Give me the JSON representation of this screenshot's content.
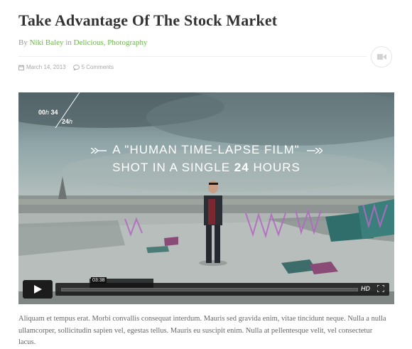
{
  "post": {
    "title": "Take Advantage Of The Stock Market",
    "by_label": "By",
    "author": "Niki Baley",
    "in_label": "in",
    "categories": [
      "Delicious",
      "Photography"
    ],
    "category_sep": ",",
    "date": "March 14, 2013",
    "comments": "5 Comments",
    "format_icon": "video-camera-icon",
    "body": "Aliquam et tempus erat. Morbi convallis consequat interdum. Mauris sed gravida enim, vitae tincidunt neque. Nulla a nulla ullamcorper, sollicitudin sapien vel, egestas tellus. Mauris eu suscipit enim. Nulla at pellentesque velit, vel consectetur lacus."
  },
  "video": {
    "timer_primary": "00",
    "timer_primary_unit": "h",
    "timer_primary_min": "34",
    "timer_total": "24",
    "timer_total_unit": "h",
    "headline_1": "A \"HUMAN TIME-LAPSE FILM\"",
    "headline_2_pre": "SHOT IN A SINGLE",
    "headline_2_num": "24",
    "headline_2_post": "HOURS",
    "current_time": "03:38",
    "hd_label": "HD",
    "progress": 0.0,
    "icons": [
      "play-icon",
      "fullscreen-icon"
    ]
  },
  "colors": {
    "accent": "#6cb64a",
    "title": "#333333",
    "muted": "#999999"
  }
}
